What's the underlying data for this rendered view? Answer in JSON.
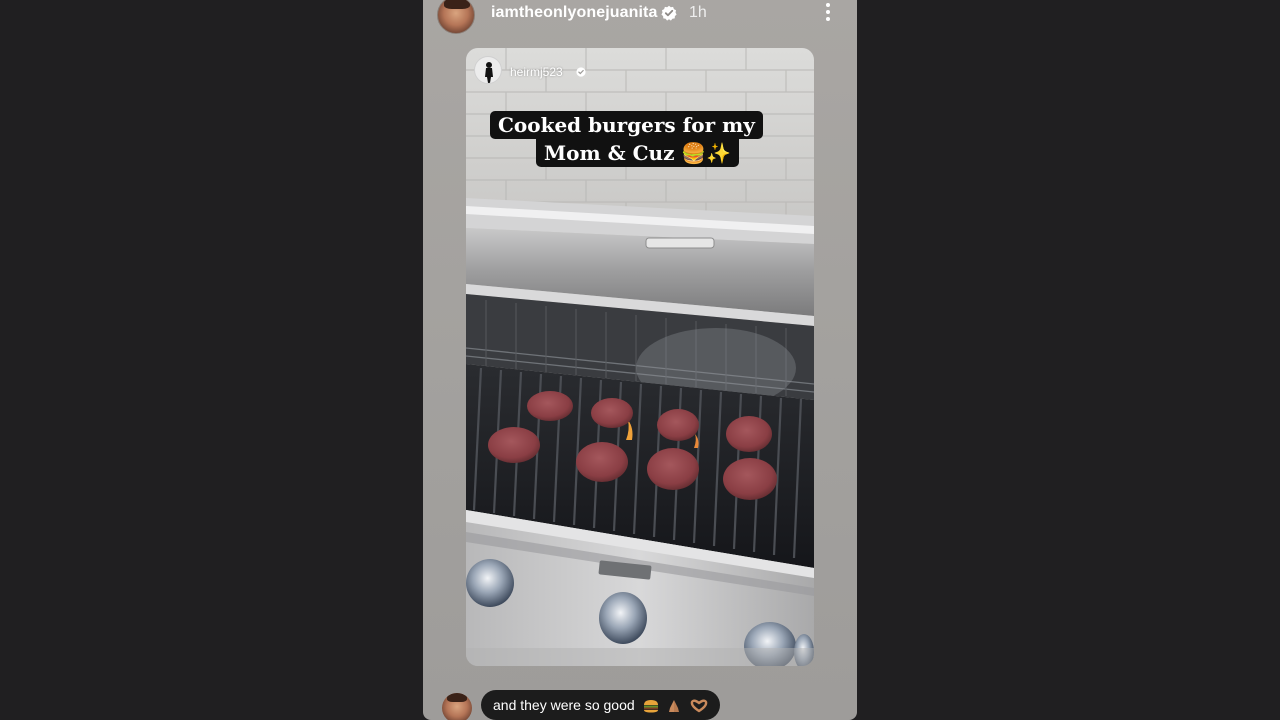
{
  "story": {
    "username": "iamtheonlyonejuanita",
    "time": "1h",
    "more_label": "More options"
  },
  "post": {
    "author": "heirmj523",
    "caption_line1": "Cooked burgers for my",
    "caption_line2": "Mom & Cuz 🍔✨"
  },
  "reply": {
    "text": "and they were so good"
  },
  "colors": {
    "page_background": "#201f21",
    "story_background": "#a6a3a1",
    "caption_background": "#111111",
    "verified_badge": "#ffffff"
  }
}
